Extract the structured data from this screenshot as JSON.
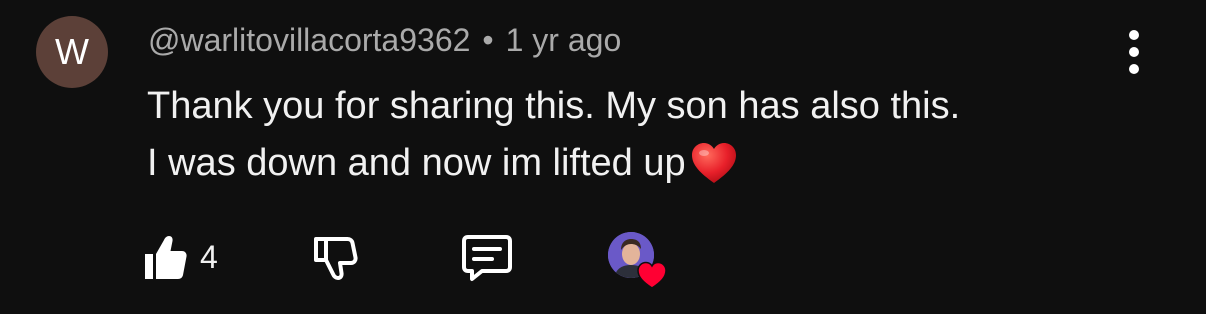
{
  "comment": {
    "avatar_letter": "W",
    "avatar_color": "#5c4038",
    "author": "@warlitovillacorta9362",
    "separator": "•",
    "timestamp": "1 yr ago",
    "text_line1": "Thank you for sharing this. My son has also this.",
    "text_line2": "I was down and now im lifted up",
    "emoji": "red-heart",
    "like_count": "4"
  },
  "icons": {
    "like": "thumbs-up-icon",
    "dislike": "thumbs-down-icon",
    "reply": "comment-icon",
    "more": "more-vertical-icon",
    "creator_heart": "heart-icon"
  },
  "colors": {
    "background": "#0f0f0f",
    "text": "#f1f1f1",
    "secondary_text": "#aaaaaa",
    "heart": "#ff0033",
    "creator_avatar": "#6a59c8"
  }
}
